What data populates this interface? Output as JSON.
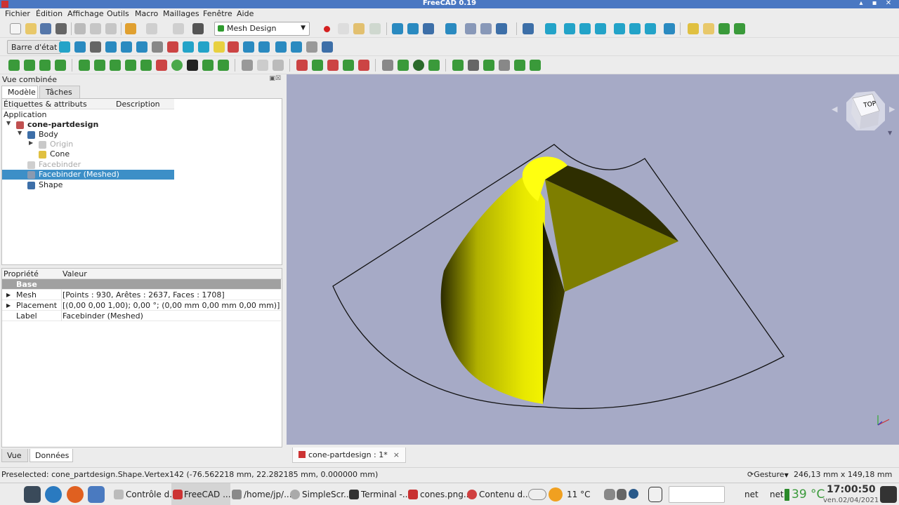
{
  "window": {
    "title": "FreeCAD 0.19"
  },
  "menu": [
    "Fichier",
    "Édition",
    "Affichage",
    "Outils",
    "Macro",
    "Maillages",
    "Fenêtre",
    "Aide"
  ],
  "toolbar": {
    "workbench": "Mesh Design",
    "status_button": "Barre d'état"
  },
  "panel": {
    "title": "Vue combinée",
    "tabs": [
      "Modèle",
      "Tâches"
    ],
    "tree_headers": [
      "Étiquettes & attributs",
      "Description"
    ],
    "tree": {
      "application": "Application",
      "document": "cone-partdesign",
      "body": "Body",
      "origin": "Origin",
      "cone": "Cone",
      "facebinder": "Facebinder",
      "facebinder_meshed": "Facebinder (Meshed)",
      "shape": "Shape"
    },
    "prop_headers": [
      "Propriété",
      "Valeur"
    ],
    "props": {
      "group": "Base",
      "mesh_label": "Mesh",
      "mesh_value": "[Points : 930, Arêtes : 2637, Faces : 1708]",
      "placement_label": "Placement",
      "placement_value": "[(0,00 0,00 1,00); 0,00 °; (0,00 mm  0,00 mm  0,00 mm)]",
      "label_label": "Label",
      "label_value": "Facebinder (Meshed)"
    },
    "bottom_tabs": [
      "Vue",
      "Données"
    ]
  },
  "viewport": {
    "navcube_face": "TOP",
    "background": "#a6aac6",
    "mesh_color": "#e0e000"
  },
  "document_tab": {
    "label": "cone-partdesign : 1*",
    "close": "×"
  },
  "statusbar": {
    "message": "Preselected: cone_partdesign.Shape.Vertex142 (-76.562218 mm, 22.282185 mm, 0.000000 mm)",
    "nav_style": "Gesture",
    "dimensions": "246,13 mm x 149,18 mm"
  },
  "taskbar": {
    "tasks": [
      "Contrôle d...",
      "FreeCAD ...",
      "/home/jp/...",
      "SimpleScr...",
      "Terminal -...",
      "cones.png...",
      "Contenu d..."
    ],
    "weather_temp": "11 °C",
    "net1": "net",
    "net2": "net",
    "cpu_temp": "39 °C",
    "time": "17:00:50",
    "date": "ven.02/04/2021"
  }
}
